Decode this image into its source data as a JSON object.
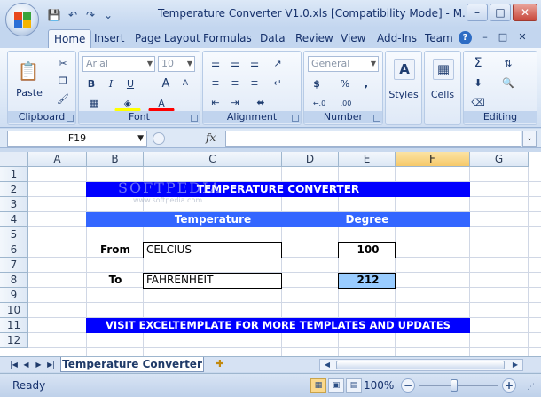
{
  "window": {
    "title": "Temperature Converter V1.0.xls  [Compatibility Mode] - M...",
    "min": "–",
    "max": "□",
    "close": "✕"
  },
  "qat": [
    "💾",
    "↶",
    "↷",
    "⌄"
  ],
  "tabs": [
    "Home",
    "Insert",
    "Page Layout",
    "Formulas",
    "Data",
    "Review",
    "View",
    "Add-Ins",
    "Team"
  ],
  "help": "?",
  "mdi": [
    "–",
    "□",
    "✕"
  ],
  "ribbon": {
    "clipboard": {
      "label": "Clipboard",
      "paste": "Paste"
    },
    "font": {
      "label": "Font",
      "name": "Arial",
      "size": "10",
      "bold": "B",
      "italic": "I",
      "underline": "U",
      "grow": "A",
      "shrink": "A",
      "color": "A"
    },
    "alignment": {
      "label": "Alignment"
    },
    "number": {
      "label": "Number",
      "format": "General",
      "currency": "$",
      "percent": "%",
      "comma": ",",
      "inc": "←.0",
      "dec": ".00"
    },
    "styles": {
      "label": "Styles"
    },
    "cells": {
      "label": "Cells"
    },
    "editing": {
      "label": "Editing",
      "sum": "Σ"
    }
  },
  "formula_bar": {
    "name_box": "F19",
    "fx": "fx",
    "formula": ""
  },
  "columns": [
    "A",
    "B",
    "C",
    "D",
    "E",
    "F",
    "G"
  ],
  "rows": [
    "1",
    "2",
    "3",
    "4",
    "5",
    "6",
    "7",
    "8",
    "9",
    "10",
    "11",
    "12"
  ],
  "selected": {
    "col": "F",
    "row": "19"
  },
  "sheet": {
    "title_band": "TEMPERATURE CONVERTER",
    "head_temperature": "Temperature",
    "head_degree": "Degree",
    "from_label": "From",
    "from_unit": "CELCIUS",
    "from_value": "100",
    "to_label": "To",
    "to_unit": "FAHRENHEIT",
    "to_value": "212",
    "footer_band": "VISIT EXCELTEMPLATE FOR MORE TEMPLATES AND UPDATES",
    "watermark": "SOFTPEDIA",
    "watermark_url": "www.softpedia.com"
  },
  "sheet_tabs": {
    "active": "Temperature Converter",
    "nav": [
      "|◀",
      "◀",
      "▶",
      "▶|"
    ]
  },
  "status": {
    "text": "Ready",
    "zoom": "100%",
    "zoom_out": "−",
    "zoom_in": "+"
  },
  "colors": {
    "band_blue": "#0000ff",
    "header_blue": "#3366ff",
    "highlight_cell": "#99ccff",
    "selection": "#f6c96a"
  }
}
